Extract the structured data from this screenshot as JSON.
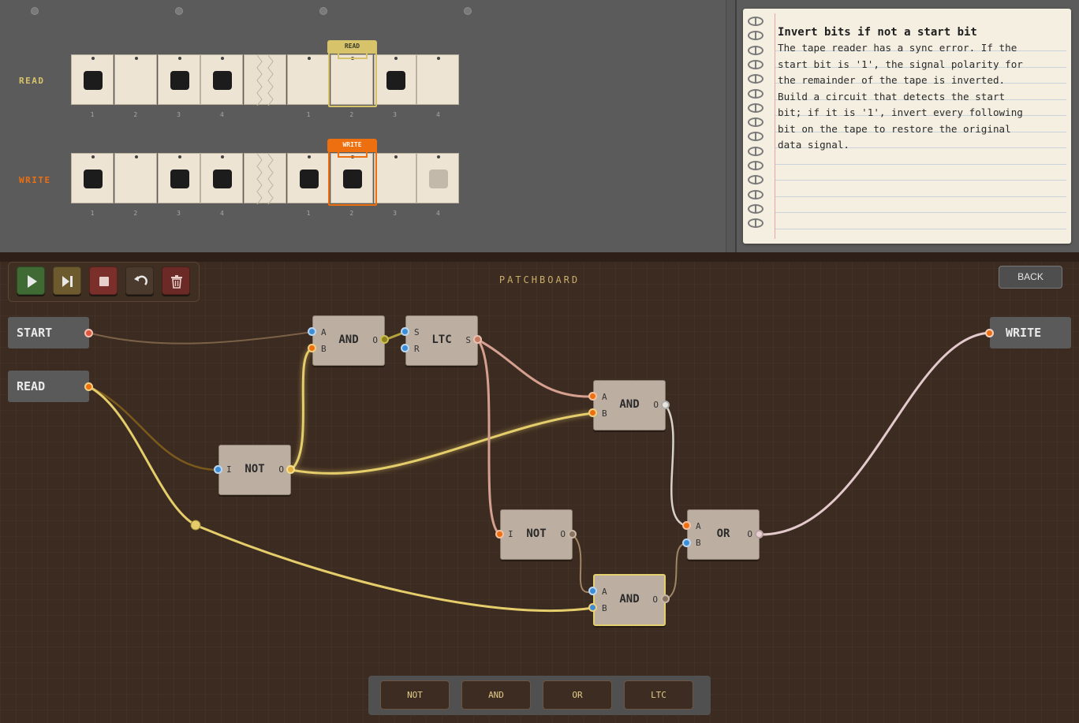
{
  "tapes": {
    "read": {
      "label": "READ",
      "head_label": "READ",
      "color": "#d7c46a",
      "cells": [
        1,
        0,
        1,
        1,
        null,
        0,
        0,
        1,
        0
      ],
      "numbers": [
        "1",
        "2",
        "3",
        "4",
        "",
        "1",
        "2",
        "3",
        "4"
      ]
    },
    "write": {
      "label": "WRITE",
      "head_label": "WRITE",
      "color": "#ee6f10",
      "cells": [
        1,
        0,
        1,
        1,
        null,
        1,
        1,
        0,
        "ghost"
      ],
      "numbers": [
        "1",
        "2",
        "3",
        "4",
        "",
        "1",
        "2",
        "3",
        "4"
      ]
    }
  },
  "notes": {
    "title": "Invert bits if not a start bit",
    "body": "The tape reader has a sync error. If the\nstart bit is '1', the signal polarity for\nthe remainder of the tape is inverted.\nBuild a circuit that detects the start\nbit; if it is '1', invert every following\nbit on the tape to restore the original\ndata signal."
  },
  "patchboard": {
    "title": "PATCHBOARD",
    "back_label": "BACK",
    "controls": [
      {
        "name": "play-button",
        "icon": "play-icon",
        "color": "#3f6a34"
      },
      {
        "name": "step-button",
        "icon": "step-icon",
        "color": "#6d5a2f"
      },
      {
        "name": "stop-button",
        "icon": "stop-icon",
        "color": "#7a2f2a"
      },
      {
        "name": "undo-button",
        "icon": "undo-icon",
        "color": "#4a3a2e"
      },
      {
        "name": "delete-button",
        "icon": "trash-icon",
        "color": "#6b2a26"
      }
    ],
    "io": {
      "start": "START",
      "read": "READ",
      "write": "WRITE"
    },
    "gates": {
      "and1": {
        "name": "AND",
        "ports": [
          "A",
          "B",
          "O"
        ]
      },
      "ltc": {
        "name": "LTC",
        "ports": [
          "S",
          "R",
          "S"
        ]
      },
      "not1": {
        "name": "NOT",
        "ports": [
          "I",
          "O"
        ]
      },
      "and2": {
        "name": "AND",
        "ports": [
          "A",
          "B",
          "O"
        ]
      },
      "not2": {
        "name": "NOT",
        "ports": [
          "I",
          "O"
        ]
      },
      "or1": {
        "name": "OR",
        "ports": [
          "A",
          "B",
          "O"
        ]
      },
      "and3": {
        "name": "AND",
        "ports": [
          "A",
          "B",
          "O"
        ]
      }
    },
    "palette": [
      "NOT",
      "AND",
      "OR",
      "LTC"
    ]
  }
}
